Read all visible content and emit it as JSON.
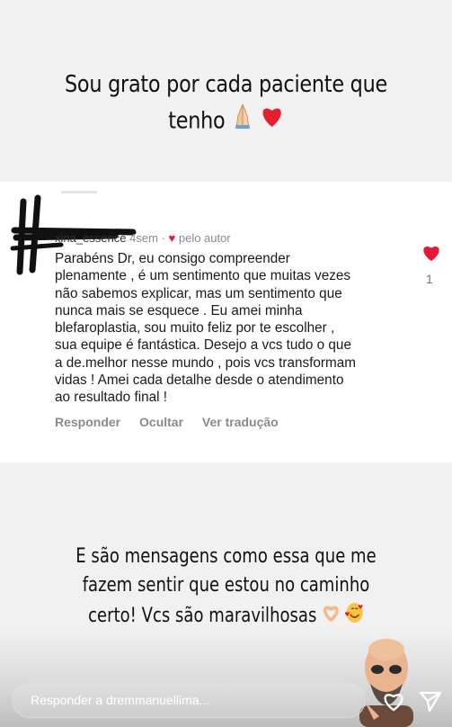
{
  "story": {
    "headline_line1": "Sou grato por cada paciente que",
    "headline_line2": "tenho",
    "headline_emojis": [
      "folded-hands",
      "red-heart"
    ]
  },
  "comment": {
    "username": "xina_essence",
    "age": "4sem",
    "liked_by_author": "pelo autor",
    "text": "Parabéns Dr, eu consigo compreender\nplenamente , é um sentimento que muitas vezes\nnão sabemos explicar, mas um sentimento que\nnunca mais se esquece . Eu amei minha\nblefaroplastia, sou muito feliz por te escolher ,\nsua equipe é fantástica. Desejo a vcs tudo o que\na de.melhor nesse mundo , pois vcs transformam\nvidas ! Amei cada detalhe desde o atendimento\nao resultado final !",
    "actions": [
      "Responder",
      "Ocultar",
      "Ver tradução"
    ],
    "like_count": "1"
  },
  "caption": {
    "line1": "E são mensagens como essa que me",
    "line2": "fazem sentir que estou no caminho",
    "line3": "certo! Vcs são maravilhosas",
    "emojis": [
      "heart-hands",
      "smiling-face-with-hearts"
    ]
  },
  "reply": {
    "placeholder": "Responder a dremmanuellima..."
  },
  "colors": {
    "heart_red": "#e8173a",
    "meta_gray": "#8a8a8a"
  }
}
